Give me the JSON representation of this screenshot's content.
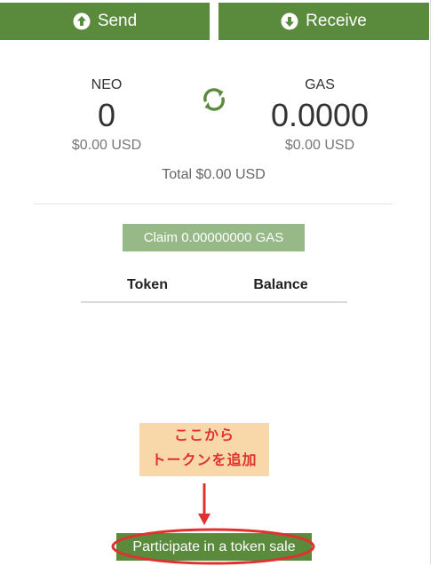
{
  "actions": {
    "send_label": "Send",
    "receive_label": "Receive",
    "send_icon": "arrow-up-circle-icon",
    "receive_icon": "arrow-down-circle-icon"
  },
  "balances": {
    "neo": {
      "name": "NEO",
      "amount": "0",
      "usd": "$0.00 USD"
    },
    "gas": {
      "name": "GAS",
      "amount": "0.0000",
      "usd": "$0.00 USD"
    },
    "refresh_icon": "refresh-icon",
    "total": "Total $0.00 USD"
  },
  "claim": {
    "label": "Claim 0.00000000 GAS"
  },
  "tokens": {
    "columns": [
      "Token",
      "Balance"
    ],
    "rows": []
  },
  "annotation": {
    "lines": [
      "ここから",
      "トークンを追加"
    ]
  },
  "token_sale": {
    "label": "Participate in a token sale"
  },
  "colors": {
    "primary_green": "#5a8a3c",
    "claim_green": "#97b987",
    "annotation_red": "#e0312e",
    "annotation_bg": "#f8d7a8"
  }
}
